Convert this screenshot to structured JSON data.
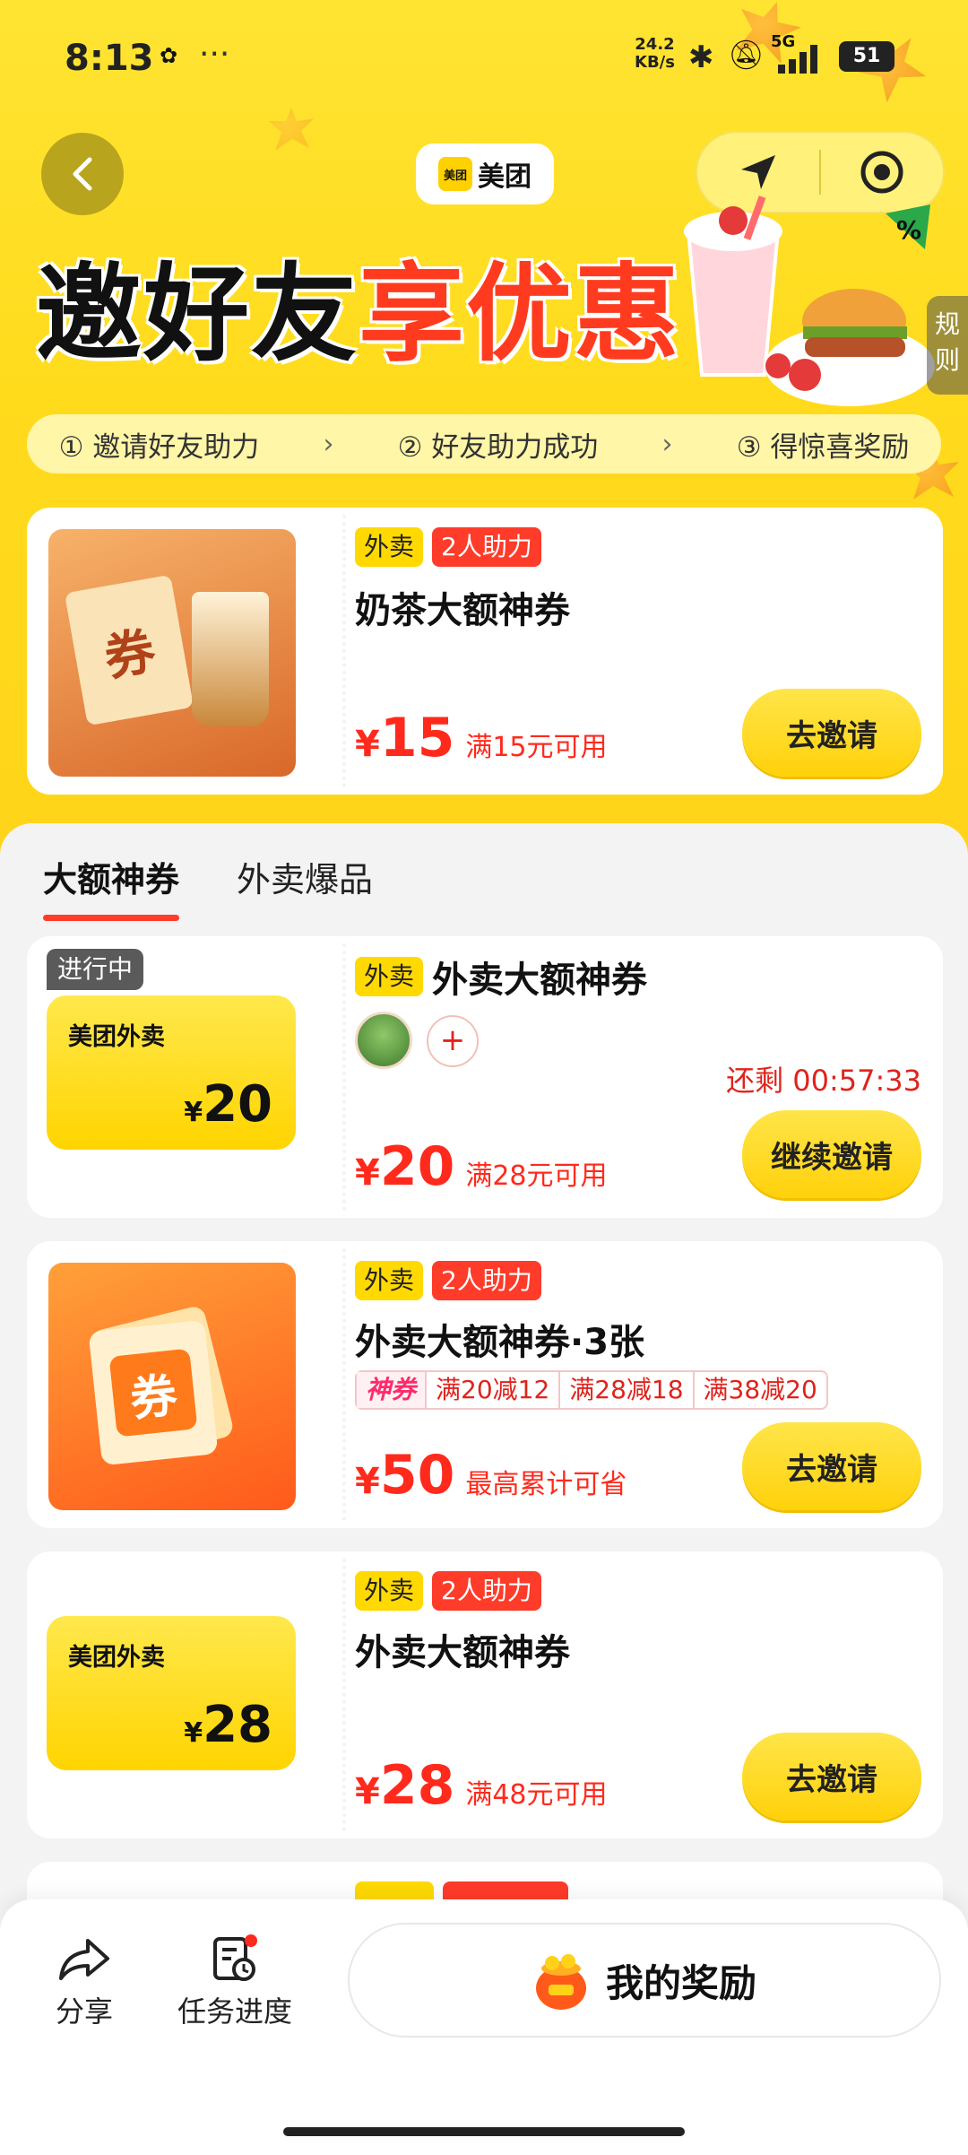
{
  "status_bar": {
    "time": "8:13",
    "dots": "···",
    "speed_value": "24.2",
    "speed_unit": "KB/s",
    "network": "5G",
    "battery": "51"
  },
  "header": {
    "logo_mark": "美团",
    "logo_text": "美团"
  },
  "hero": {
    "headline_black": "邀好友",
    "headline_red": "享优惠",
    "rules_label": "规则"
  },
  "steps": [
    {
      "num": "①",
      "label": "邀请好友助力"
    },
    {
      "num": "②",
      "label": "好友助力成功"
    },
    {
      "num": "③",
      "label": "得惊喜奖励"
    }
  ],
  "featured": {
    "tag1": "外卖",
    "tag2": "2人助力",
    "title": "奶茶大额神券",
    "image_glyph": "券",
    "currency": "¥",
    "price": "15",
    "condition": "满15元可用",
    "button": "去邀请"
  },
  "tabs": [
    {
      "label": "大额神券",
      "active": true
    },
    {
      "label": "外卖爆品",
      "active": false
    }
  ],
  "coupons": [
    {
      "status": "进行中",
      "brand": "美团外卖",
      "amount_currency": "¥",
      "amount": "20",
      "tag1": "外卖",
      "title": "外卖大额神券",
      "add": "+",
      "remaining": "还剩 00:57:33",
      "currency": "¥",
      "price": "20",
      "condition": "满28元可用",
      "button": "继续邀请"
    },
    {
      "image_glyph": "券",
      "tag1": "外卖",
      "tag2": "2人助力",
      "title": "外卖大额神券·3张",
      "sub_badge": "神券",
      "subs": [
        "满20减12",
        "满28减18",
        "满38减20"
      ],
      "currency": "¥",
      "price": "50",
      "condition": "最高累计可省",
      "button": "去邀请"
    },
    {
      "brand": "美团外卖",
      "amount_currency": "¥",
      "amount": "28",
      "tag1": "外卖",
      "tag2": "2人助力",
      "title": "外卖大额神券",
      "currency": "¥",
      "price": "28",
      "condition": "满48元可用",
      "button": "去邀请"
    }
  ],
  "bottom_bar": {
    "share": "分享",
    "progress": "任务进度",
    "rewards": "我的奖励"
  },
  "colors": {
    "accent_yellow": "#ffd900",
    "accent_red": "#ff3b2a",
    "price_red": "#ff2a1c"
  }
}
